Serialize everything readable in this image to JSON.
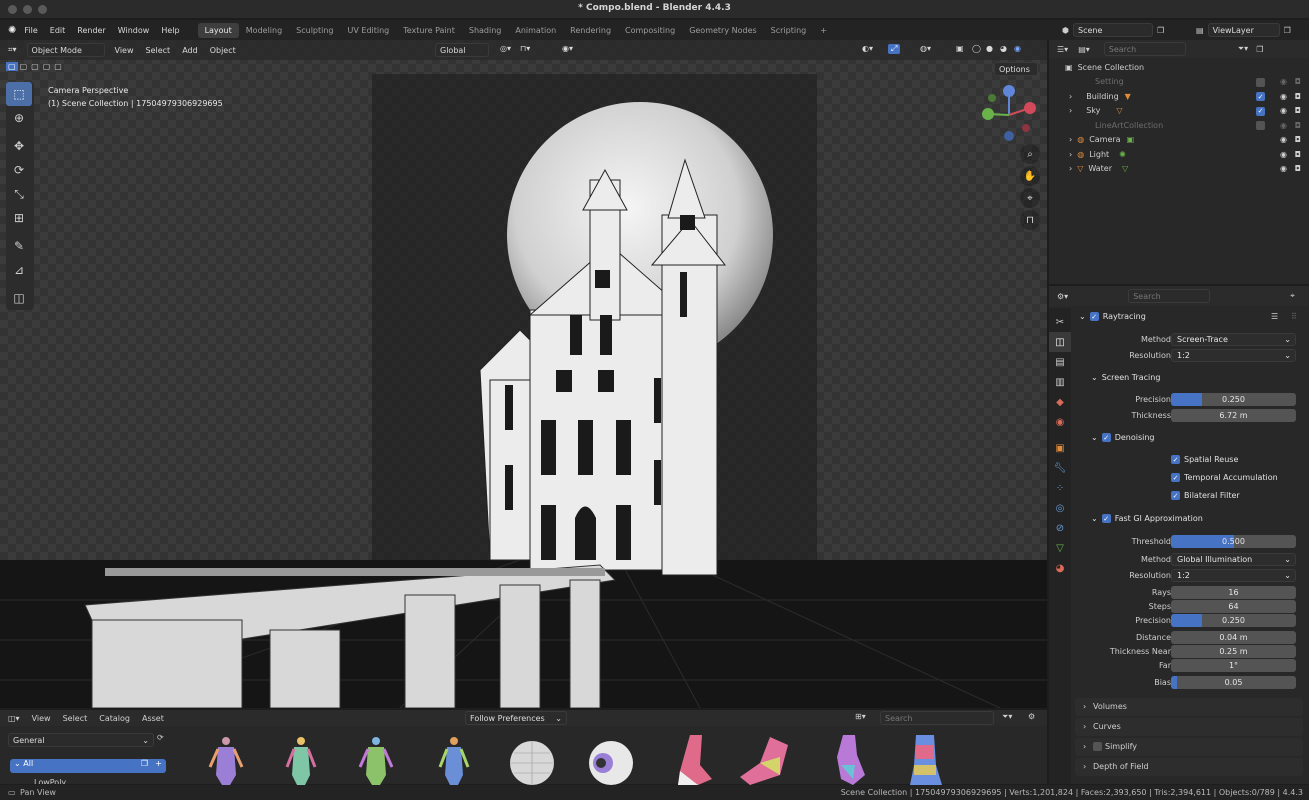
{
  "window": {
    "title": "* Compo.blend - Blender 4.4.3"
  },
  "menu": [
    "File",
    "Edit",
    "Render",
    "Window",
    "Help"
  ],
  "workspaces": [
    {
      "label": "Layout",
      "active": true
    },
    {
      "label": "Modeling"
    },
    {
      "label": "Sculpting"
    },
    {
      "label": "UV Editing"
    },
    {
      "label": "Texture Paint"
    },
    {
      "label": "Shading"
    },
    {
      "label": "Animation"
    },
    {
      "label": "Rendering"
    },
    {
      "label": "Compositing"
    },
    {
      "label": "Geometry Nodes"
    },
    {
      "label": "Scripting"
    }
  ],
  "scene": {
    "name": "Scene",
    "view_layer": "ViewLayer"
  },
  "viewport": {
    "mode": "Object Mode",
    "menu": [
      "View",
      "Select",
      "Add",
      "Object"
    ],
    "orientation": "Global",
    "options_label": "Options",
    "info_line1": "Camera Perspective",
    "info_line2": "(1) Scene Collection | 17504979306929695"
  },
  "outliner": {
    "search_placeholder": "Search",
    "root": "Scene Collection",
    "items": [
      {
        "label": "Setting",
        "dim": true,
        "checked": false
      },
      {
        "label": "Building",
        "dim": false,
        "checked": true
      },
      {
        "label": "Sky",
        "dim": false,
        "checked": true
      },
      {
        "label": "LineArtCollection",
        "dim": true,
        "checked": false
      },
      {
        "label": "Camera",
        "dim": false
      },
      {
        "label": "Light",
        "dim": false
      },
      {
        "label": "Water",
        "dim": false
      }
    ]
  },
  "properties": {
    "search_placeholder": "Search",
    "raytracing": {
      "title": "Raytracing",
      "method_label": "Method",
      "method": "Screen-Trace",
      "resolution_label": "Resolution",
      "resolution": "1:2",
      "screen_tracing": "Screen Tracing",
      "precision_label": "Precision",
      "precision": "0.250",
      "precision_value": 0.25,
      "thickness_label": "Thickness",
      "thickness": "6.72 m",
      "denoising": "Denoising",
      "spatial_reuse": "Spatial Reuse",
      "temporal_accumulation": "Temporal Accumulation",
      "bilateral_filter": "Bilateral Filter",
      "fast_gi": "Fast GI Approximation",
      "threshold_label": "Threshold",
      "threshold": "0.500",
      "threshold_value": 0.5,
      "gi_method_label": "Method",
      "gi_method": "Global Illumination",
      "gi_resolution_label": "Resolution",
      "gi_resolution": "1:2",
      "rays_label": "Rays",
      "rays": "16",
      "steps_label": "Steps",
      "steps": "64",
      "gi_precision_label": "Precision",
      "gi_precision": "0.250",
      "gi_precision_value": 0.25,
      "distance_label": "Distance",
      "distance": "0.04 m",
      "thickness_near_label": "Thickness Near",
      "thickness_near": "0.25 m",
      "far_label": "Far",
      "far": "1°",
      "bias_label": "Bias",
      "bias": "0.05",
      "bias_value": 0.05
    },
    "panels": [
      "Volumes",
      "Curves",
      "Simplify",
      "Depth of Field"
    ]
  },
  "assets": {
    "menu": [
      "View",
      "Select",
      "Catalog",
      "Asset"
    ],
    "library": "General",
    "import": "Follow Preferences",
    "search_placeholder": "Search",
    "catalog_all": "All",
    "catalog_sub": "LowPoly"
  },
  "status": {
    "left": "Pan View",
    "right": "Scene Collection | 17504979306929695 | Verts:1,201,824 | Faces:2,393,650 | Tris:2,394,611 | Objects:0/789 | 4.4.3"
  }
}
